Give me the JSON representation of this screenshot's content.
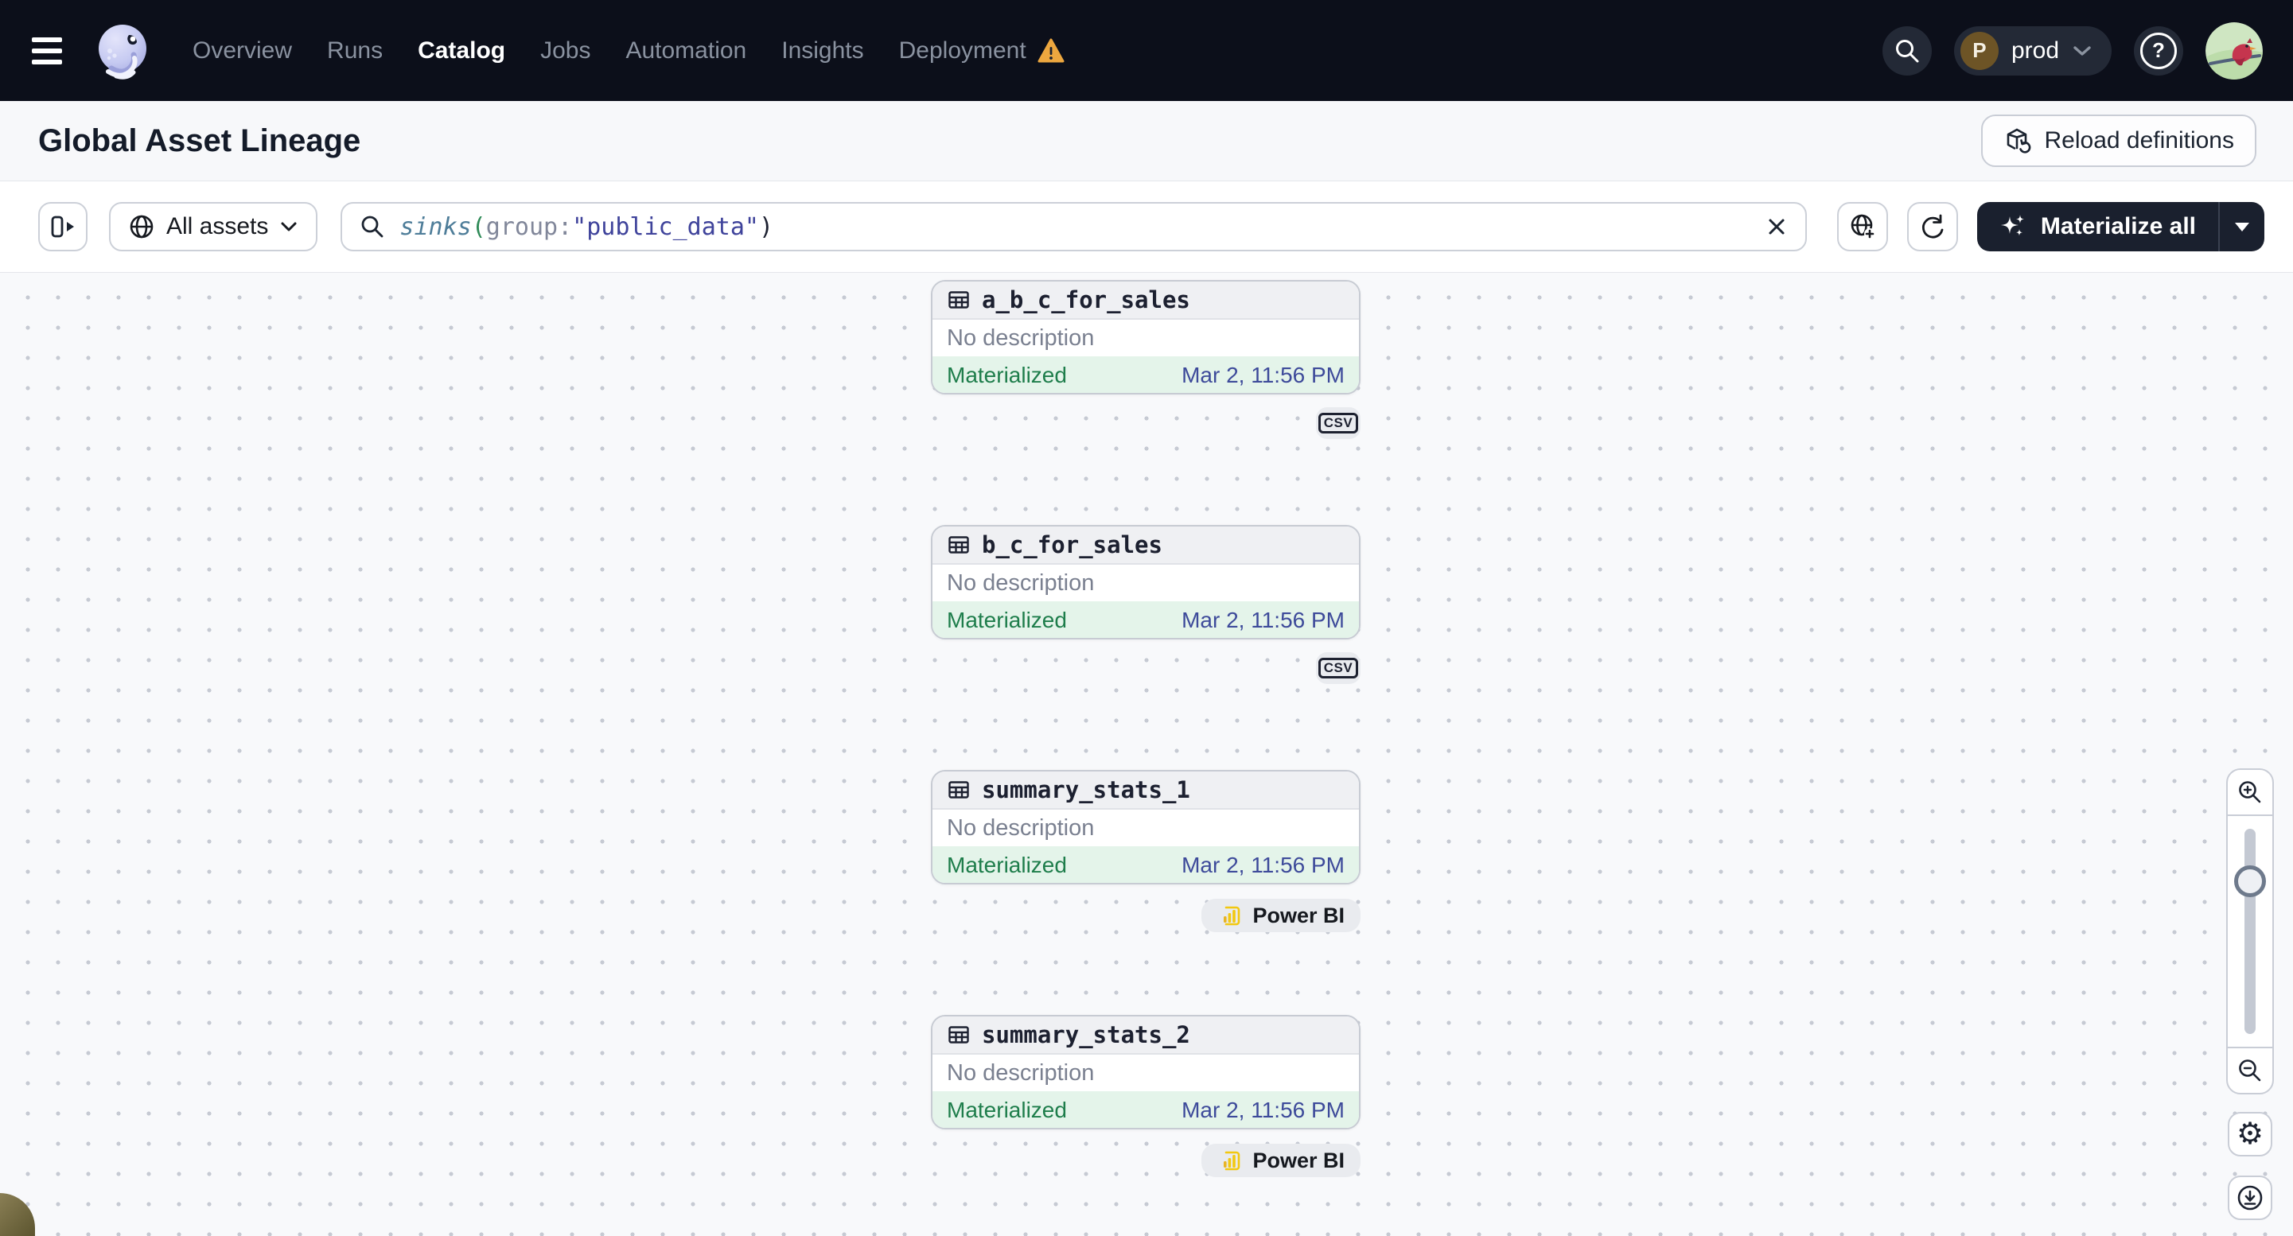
{
  "nav": {
    "items": [
      {
        "label": "Overview",
        "active": false
      },
      {
        "label": "Runs",
        "active": false
      },
      {
        "label": "Catalog",
        "active": true
      },
      {
        "label": "Jobs",
        "active": false
      },
      {
        "label": "Automation",
        "active": false
      },
      {
        "label": "Insights",
        "active": false
      },
      {
        "label": "Deployment",
        "active": false,
        "warning": true
      }
    ],
    "environment": {
      "initial": "P",
      "name": "prod"
    },
    "help_label": "?"
  },
  "header": {
    "title": "Global Asset Lineage",
    "reload_button_label": "Reload definitions"
  },
  "toolbar": {
    "scope_filter_label": "All assets",
    "search": {
      "parts": {
        "fn": "sinks",
        "open": "(",
        "key": "group",
        "colon": ":",
        "value": "\"public_data\"",
        "close": ")"
      }
    },
    "materialize_button_label": "Materialize all"
  },
  "graph": {
    "nodes": [
      {
        "name": "a_b_c_for_sales",
        "description": "No description",
        "status": "Materialized",
        "timestamp": "Mar 2, 11:56 PM",
        "tag": "CSV"
      },
      {
        "name": "b_c_for_sales",
        "description": "No description",
        "status": "Materialized",
        "timestamp": "Mar 2, 11:56 PM",
        "tag": "CSV"
      },
      {
        "name": "summary_stats_1",
        "description": "No description",
        "status": "Materialized",
        "timestamp": "Mar 2, 11:56 PM",
        "tag": "Power BI"
      },
      {
        "name": "summary_stats_2",
        "description": "No description",
        "status": "Materialized",
        "timestamp": "Mar 2, 11:56 PM",
        "tag": "Power BI"
      }
    ]
  },
  "colors": {
    "nav_bg": "#0c0f1a",
    "accent_dark": "#1a202e",
    "status_green": "#1e7d4b",
    "status_green_bg": "#e4f4ea",
    "timestamp_blue": "#3d4a9a",
    "warning_orange": "#eda73f",
    "powerbi_yellow": "#f2c811",
    "canvas_bg": "#f8f9fb"
  }
}
